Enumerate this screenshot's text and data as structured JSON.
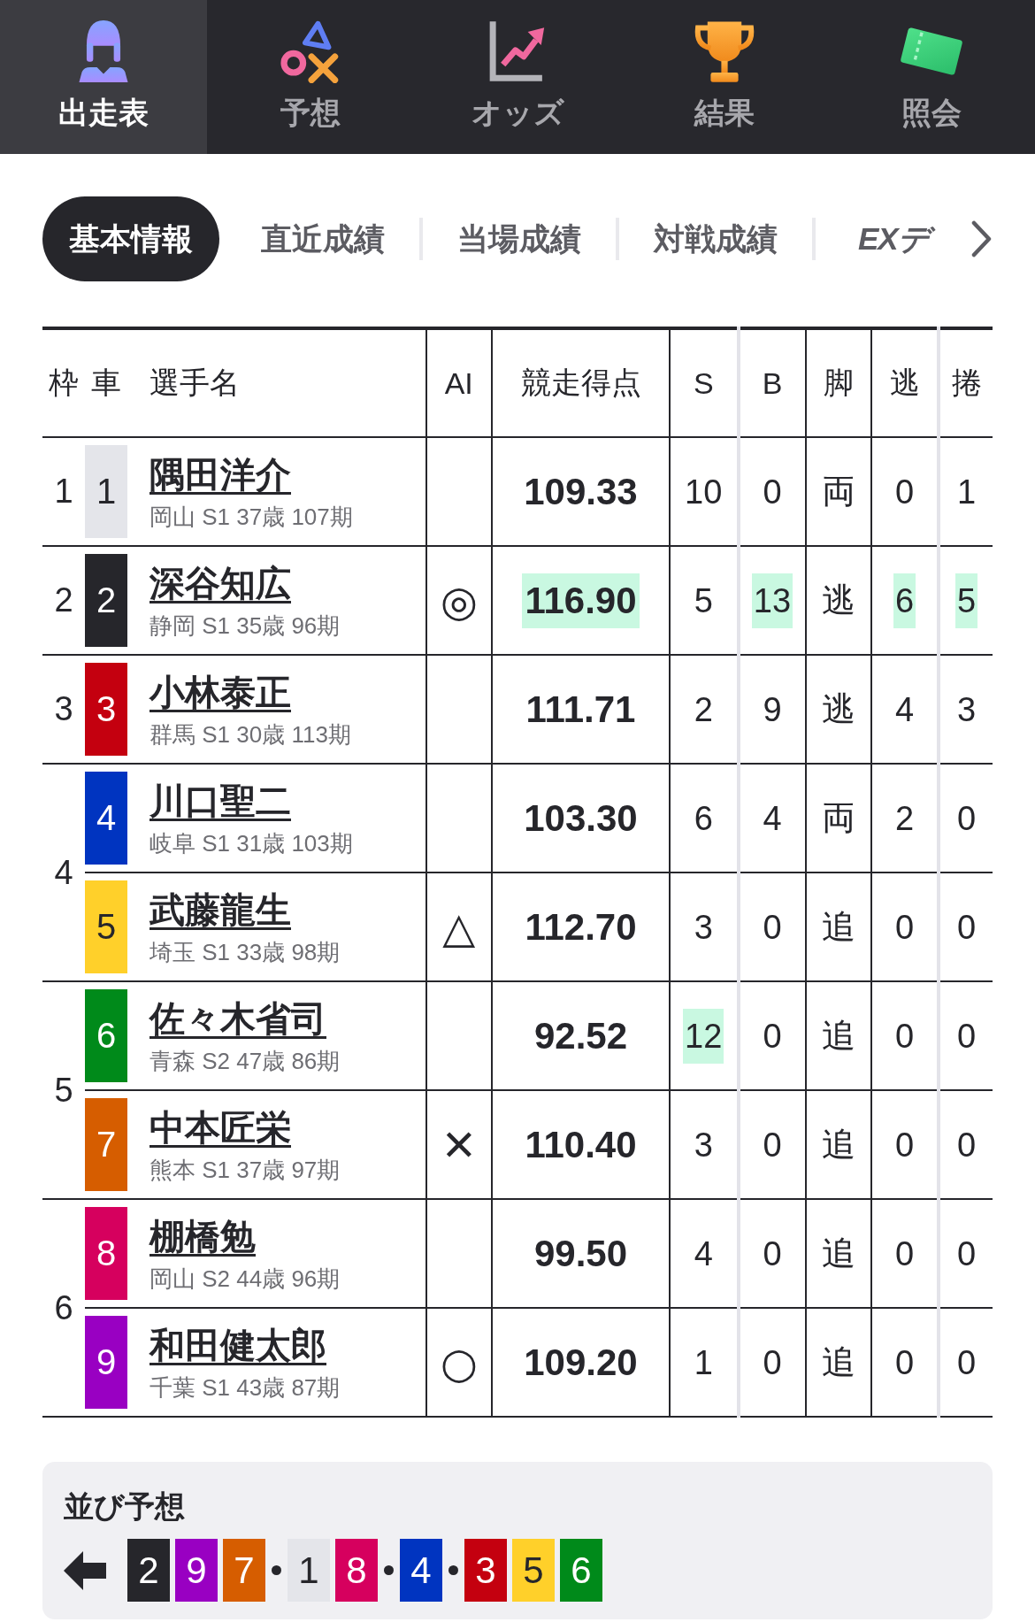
{
  "nav": {
    "items": [
      {
        "label": "出走表",
        "selected": true
      },
      {
        "label": "予想",
        "selected": false
      },
      {
        "label": "オッズ",
        "selected": false
      },
      {
        "label": "結果",
        "selected": false
      },
      {
        "label": "照会",
        "selected": false
      }
    ]
  },
  "tabs": [
    {
      "label": "基本情報",
      "kind": "text",
      "selected": true
    },
    {
      "label": "直近成績",
      "kind": "text",
      "selected": false
    },
    {
      "label": "当場成績",
      "kind": "text",
      "selected": false
    },
    {
      "label": "対戦成績",
      "kind": "text",
      "selected": false
    },
    {
      "label": "EXデ",
      "kind": "logo",
      "selected": false
    }
  ],
  "table": {
    "columns": [
      "枠",
      "車",
      "選手名",
      "AI",
      "競走得点",
      "S",
      "B",
      "脚",
      "逃",
      "捲"
    ],
    "frames": [
      {
        "number": "1",
        "riders": [
          {
            "car": "1",
            "color": "#e4e5ea",
            "name": "隅田洋介",
            "profile": "岡山 S1 37歳 107期",
            "score": {
              "value": "109.33",
              "highlight": false
            },
            "s": {
              "value": "10",
              "highlight": false
            },
            "b": {
              "value": "0",
              "highlight": false
            },
            "leg": "両",
            "nige": {
              "value": "0",
              "highlight": false
            },
            "makuri": {
              "value": "1",
              "highlight": false
            }
          }
        ]
      },
      {
        "number": "2",
        "riders": [
          {
            "car": "2",
            "color": "#26262b",
            "name": "深谷知広",
            "profile": "静岡 S1 35歳 96期",
            "ai_mark": "◎",
            "score": {
              "value": "116.90",
              "highlight": true
            },
            "s": {
              "value": "5",
              "highlight": false
            },
            "b": {
              "value": "13",
              "highlight": true
            },
            "leg": "逃",
            "nige": {
              "value": "6",
              "highlight": true
            },
            "makuri": {
              "value": "5",
              "highlight": true
            }
          }
        ]
      },
      {
        "number": "3",
        "riders": [
          {
            "car": "3",
            "color": "#c4000f",
            "name": "小林泰正",
            "profile": "群馬 S1 30歳 113期",
            "score": {
              "value": "111.71",
              "highlight": false
            },
            "s": {
              "value": "2",
              "highlight": false
            },
            "b": {
              "value": "9",
              "highlight": false
            },
            "leg": "逃",
            "nige": {
              "value": "4",
              "highlight": false
            },
            "makuri": {
              "value": "3",
              "highlight": false
            }
          }
        ]
      },
      {
        "number": "4",
        "riders": [
          {
            "car": "4",
            "color": "#0034c0",
            "name": "川口聖二",
            "profile": "岐阜 S1 31歳 103期",
            "score": {
              "value": "103.30",
              "highlight": false
            },
            "s": {
              "value": "6",
              "highlight": false
            },
            "b": {
              "value": "4",
              "highlight": false
            },
            "leg": "両",
            "nige": {
              "value": "2",
              "highlight": false
            },
            "makuri": {
              "value": "0",
              "highlight": false
            }
          },
          {
            "car": "5",
            "color": "#ffd02a",
            "name": "武藤龍生",
            "profile": "埼玉 S1 33歳 98期",
            "ai_mark": "△",
            "score": {
              "value": "112.70",
              "highlight": false
            },
            "s": {
              "value": "3",
              "highlight": false
            },
            "b": {
              "value": "0",
              "highlight": false
            },
            "leg": "追",
            "nige": {
              "value": "0",
              "highlight": false
            },
            "makuri": {
              "value": "0",
              "highlight": false
            }
          }
        ]
      },
      {
        "number": "5",
        "riders": [
          {
            "car": "6",
            "color": "#008a1a",
            "name": "佐々木省司",
            "profile": "青森 S2 47歳 86期",
            "score": {
              "value": "92.52",
              "highlight": false
            },
            "s": {
              "value": "12",
              "highlight": true
            },
            "b": {
              "value": "0",
              "highlight": false
            },
            "leg": "追",
            "nige": {
              "value": "0",
              "highlight": false
            },
            "makuri": {
              "value": "0",
              "highlight": false
            }
          },
          {
            "car": "7",
            "color": "#d65d00",
            "name": "中本匠栄",
            "profile": "熊本 S1 37歳 97期",
            "ai_mark": "✕",
            "score": {
              "value": "110.40",
              "highlight": false
            },
            "s": {
              "value": "3",
              "highlight": false
            },
            "b": {
              "value": "0",
              "highlight": false
            },
            "leg": "追",
            "nige": {
              "value": "0",
              "highlight": false
            },
            "makuri": {
              "value": "0",
              "highlight": false
            }
          }
        ]
      },
      {
        "number": "6",
        "riders": [
          {
            "car": "8",
            "color": "#d6005e",
            "name": "棚橋勉",
            "profile": "岡山 S2 44歳 96期",
            "score": {
              "value": "99.50",
              "highlight": false
            },
            "s": {
              "value": "4",
              "highlight": false
            },
            "b": {
              "value": "0",
              "highlight": false
            },
            "leg": "追",
            "nige": {
              "value": "0",
              "highlight": false
            },
            "makuri": {
              "value": "0",
              "highlight": false
            }
          },
          {
            "car": "9",
            "color": "#9900c2",
            "name": "和田健太郎",
            "profile": "千葉 S1 43歳 87期",
            "ai_mark": "○",
            "score": {
              "value": "109.20",
              "highlight": false
            },
            "s": {
              "value": "1",
              "highlight": false
            },
            "b": {
              "value": "0",
              "highlight": false
            },
            "leg": "追",
            "nige": {
              "value": "0",
              "highlight": false
            },
            "makuri": {
              "value": "0",
              "highlight": false
            }
          }
        ]
      }
    ]
  },
  "lineup": {
    "title": "並び予想",
    "groups": [
      {
        "cars": [
          {
            "number": "2",
            "color": "#26262b"
          },
          {
            "number": "9",
            "color": "#9900c2"
          },
          {
            "number": "7",
            "color": "#d65d00"
          }
        ]
      },
      {
        "cars": [
          {
            "number": "1",
            "color": "#e4e5ea"
          },
          {
            "number": "8",
            "color": "#d6005e"
          }
        ]
      },
      {
        "cars": [
          {
            "number": "4",
            "color": "#0034c0"
          }
        ]
      },
      {
        "cars": [
          {
            "number": "3",
            "color": "#c4000f"
          },
          {
            "number": "5",
            "color": "#ffd02a"
          },
          {
            "number": "6",
            "color": "#008a1a"
          }
        ]
      }
    ]
  }
}
